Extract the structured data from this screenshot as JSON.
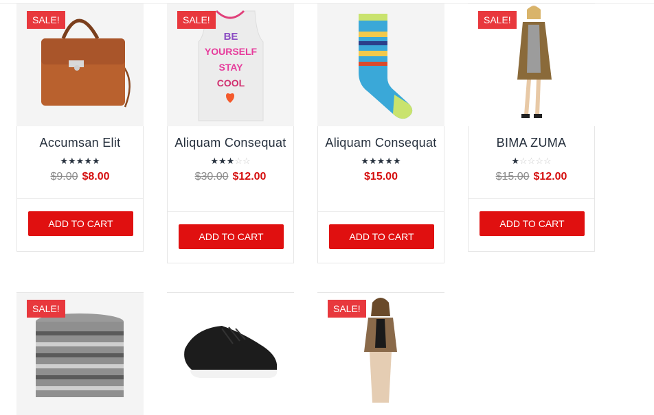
{
  "products": [
    {
      "title": "Accumsan Elit",
      "badge": "SALE!",
      "rating": 5,
      "old_price": "$9.00",
      "price": "$8.00",
      "button": "ADD TO CART"
    },
    {
      "title": "Aliquam Consequat",
      "badge": "SALE!",
      "rating": 3,
      "old_price": "$30.00",
      "price": "$12.00",
      "button": "ADD TO CART"
    },
    {
      "title": "Aliquam Consequat",
      "badge": "",
      "rating": 5,
      "old_price": "",
      "price": "$15.00",
      "button": "ADD TO CART"
    },
    {
      "title": "BIMA ZUMA",
      "badge": "SALE!",
      "rating": 1,
      "old_price": "$15.00",
      "price": "$12.00",
      "button": "ADD TO CART"
    },
    {
      "badge": "SALE!"
    },
    {
      "badge": ""
    },
    {
      "badge": "SALE!"
    }
  ],
  "tank_text": [
    "BE",
    "YOURSELF",
    "STAY",
    "COOL"
  ],
  "colors": {
    "accent": "#e01010",
    "badge": "#e8383d",
    "price": "#d50e0e"
  }
}
